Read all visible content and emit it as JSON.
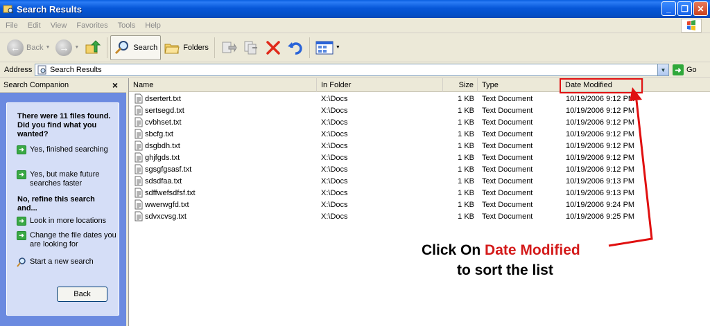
{
  "window": {
    "title": "Search Results"
  },
  "menu": [
    "File",
    "Edit",
    "View",
    "Favorites",
    "Tools",
    "Help"
  ],
  "toolbar": {
    "back_label": "Back",
    "search_label": "Search",
    "folders_label": "Folders"
  },
  "address": {
    "label": "Address",
    "value": "Search Results",
    "go_label": "Go"
  },
  "companion": {
    "title": "Search Companion",
    "close_glyph": "×",
    "heading1": "There were 11 files found. Did you find what you wanted?",
    "link_finished": "Yes, finished searching",
    "link_faster": "Yes, but make future searches faster",
    "heading2": "No, refine this search and...",
    "link_more_locations": "Look in more locations",
    "link_change_dates": "Change the file dates you are looking for",
    "link_new_search": "Start a new search",
    "back_button": "Back"
  },
  "columns": {
    "name": "Name",
    "folder": "In Folder",
    "size": "Size",
    "type": "Type",
    "modified": "Date Modified"
  },
  "files": [
    {
      "name": "dsertert.txt",
      "folder": "X:\\Docs",
      "size": "1 KB",
      "type": "Text Document",
      "modified": "10/19/2006 9:12 PM"
    },
    {
      "name": "sertsegd.txt",
      "folder": "X:\\Docs",
      "size": "1 KB",
      "type": "Text Document",
      "modified": "10/19/2006 9:12 PM"
    },
    {
      "name": "cvbhset.txt",
      "folder": "X:\\Docs",
      "size": "1 KB",
      "type": "Text Document",
      "modified": "10/19/2006 9:12 PM"
    },
    {
      "name": "sbcfg.txt",
      "folder": "X:\\Docs",
      "size": "1 KB",
      "type": "Text Document",
      "modified": "10/19/2006 9:12 PM"
    },
    {
      "name": "dsgbdh.txt",
      "folder": "X:\\Docs",
      "size": "1 KB",
      "type": "Text Document",
      "modified": "10/19/2006 9:12 PM"
    },
    {
      "name": "ghjfgds.txt",
      "folder": "X:\\Docs",
      "size": "1 KB",
      "type": "Text Document",
      "modified": "10/19/2006 9:12 PM"
    },
    {
      "name": "sgsgfgsasf.txt",
      "folder": "X:\\Docs",
      "size": "1 KB",
      "type": "Text Document",
      "modified": "10/19/2006 9:12 PM"
    },
    {
      "name": "sdsdfaa.txt",
      "folder": "X:\\Docs",
      "size": "1 KB",
      "type": "Text Document",
      "modified": "10/19/2006 9:13 PM"
    },
    {
      "name": "sdffwefsdfsf.txt",
      "folder": "X:\\Docs",
      "size": "1 KB",
      "type": "Text Document",
      "modified": "10/19/2006 9:13 PM"
    },
    {
      "name": "wwerwgfd.txt",
      "folder": "X:\\Docs",
      "size": "1 KB",
      "type": "Text Document",
      "modified": "10/19/2006 9:24 PM"
    },
    {
      "name": "sdvxcvsg.txt",
      "folder": "X:\\Docs",
      "size": "1 KB",
      "type": "Text Document",
      "modified": "10/19/2006 9:25 PM"
    }
  ],
  "annotation": {
    "line1_prefix": "Click On ",
    "line1_highlight": "Date Modified",
    "line2": "to sort the list",
    "color": "#d41a1a"
  }
}
